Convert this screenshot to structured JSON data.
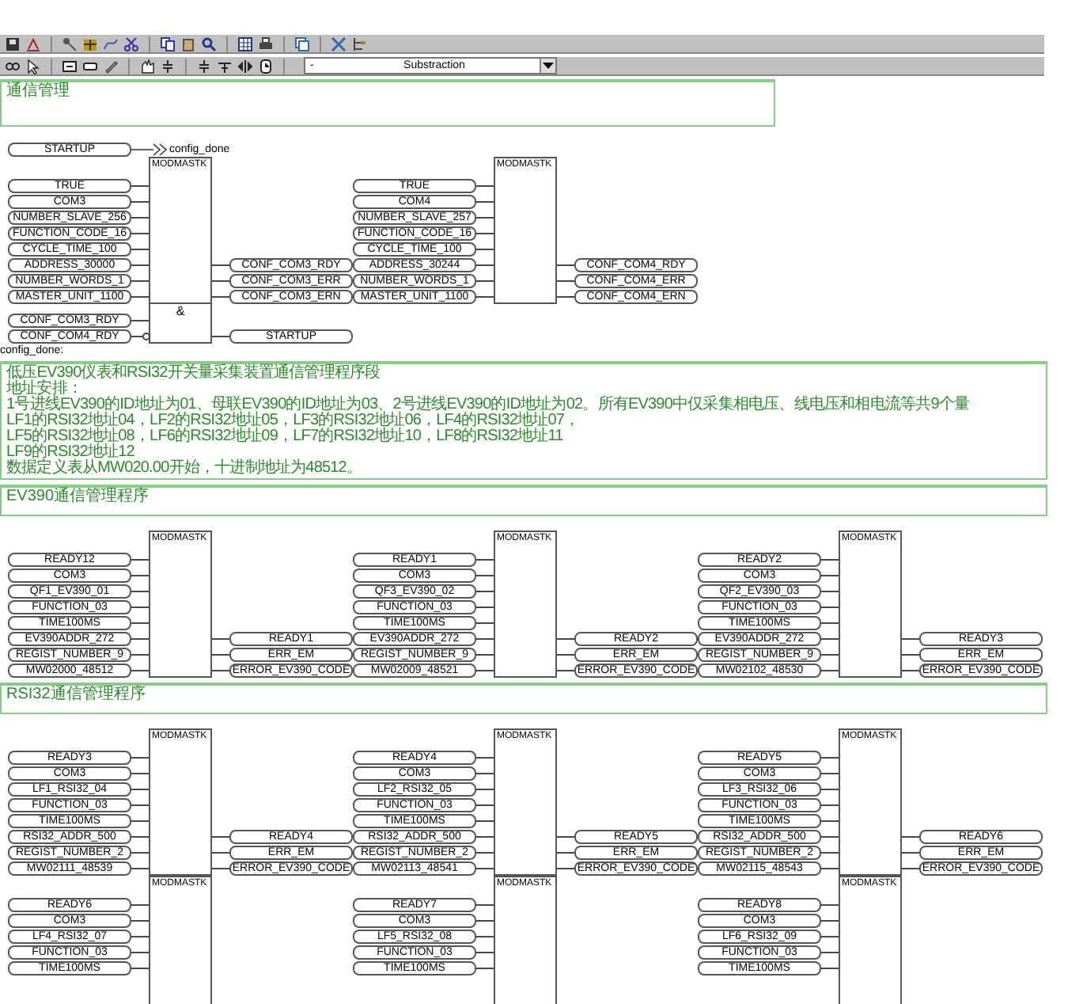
{
  "toolbar": {
    "operator": "-",
    "dropdown_value": "Substraction"
  },
  "title_comment": "通信管理",
  "init_network": {
    "jump": {
      "input": "STARTUP",
      "target": "config_done"
    },
    "blocks": [
      {
        "type": "MODMASTK",
        "inputs": [
          "TRUE",
          "COM3",
          "NUMBER_SLAVE_256",
          "FUNCTION_CODE_16",
          "CYCLE_TIME_100",
          "ADDRESS_30000",
          "NUMBER_WORDS_1",
          "MASTER_UNIT_1100"
        ],
        "outputs": [
          "CONF_COM3_RDY",
          "CONF_COM3_ERR",
          "CONF_COM3_ERN"
        ]
      },
      {
        "type": "MODMASTK",
        "inputs": [
          "TRUE",
          "COM4",
          "NUMBER_SLAVE_257",
          "FUNCTION_CODE_16",
          "CYCLE_TIME_100",
          "ADDRESS_30244",
          "NUMBER_WORDS_1",
          "MASTER_UNIT_1100"
        ],
        "outputs": [
          "CONF_COM4_RDY",
          "CONF_COM4_ERR",
          "CONF_COM4_ERN"
        ]
      }
    ],
    "and_gate": {
      "symbol": "&",
      "inputs": [
        {
          "name": "CONF_COM3_RDY",
          "negated": false
        },
        {
          "name": "CONF_COM4_RDY",
          "negated": true
        }
      ],
      "output": "STARTUP"
    }
  },
  "label": "config_done:",
  "description": [
    "低压EV390仪表和RSI32开关量采集装置通信管理程序段",
    "地址安排：",
    "1号进线EV390的ID地址为01、母联EV390的ID地址为03、2号进线EV390的ID地址为02。所有EV390中仅采集相电压、线电压和相电流等共9个量",
    "LF1的RSI32地址04，LF2的RSI32地址05，LF3的RSI32地址06，LF4的RSI32地址07，",
    "LF5的RSI32地址08，LF6的RSI32地址09，LF7的RSI32地址10，LF8的RSI32地址11",
    "LF9的RSI32地址12",
    "数据定义表从MW020.00开始，十进制地址为48512。"
  ],
  "sections": [
    {
      "title": "EV390通信管理程序",
      "rows": [
        [
          {
            "type": "MODMASTK",
            "inputs": [
              "READY12",
              "COM3",
              "QF1_EV390_01",
              "FUNCTION_03",
              "TIME100MS",
              "EV390ADDR_272",
              "REGIST_NUMBER_9",
              "MW02000_48512"
            ],
            "outputs": [
              "READY1",
              "ERR_EM",
              "ERROR_EV390_CODE"
            ]
          },
          {
            "type": "MODMASTK",
            "inputs": [
              "READY1",
              "COM3",
              "QF3_EV390_02",
              "FUNCTION_03",
              "TIME100MS",
              "EV390ADDR_272",
              "REGIST_NUMBER_9",
              "MW02009_48521"
            ],
            "outputs": [
              "READY2",
              "ERR_EM",
              "ERROR_EV390_CODE"
            ]
          },
          {
            "type": "MODMASTK",
            "inputs": [
              "READY2",
              "COM3",
              "QF2_EV390_03",
              "FUNCTION_03",
              "TIME100MS",
              "EV390ADDR_272",
              "REGIST_NUMBER_9",
              "MW02102_48530"
            ],
            "outputs": [
              "READY3",
              "ERR_EM",
              "ERROR_EV390_CODE"
            ]
          }
        ]
      ]
    },
    {
      "title": "RSI32通信管理程序",
      "rows": [
        [
          {
            "type": "MODMASTK",
            "inputs": [
              "READY3",
              "COM3",
              "LF1_RSI32_04",
              "FUNCTION_03",
              "TIME100MS",
              "RSI32_ADDR_500",
              "REGIST_NUMBER_2",
              "MW02111_48539"
            ],
            "outputs": [
              "READY4",
              "ERR_EM",
              "ERROR_EV390_CODE"
            ]
          },
          {
            "type": "MODMASTK",
            "inputs": [
              "READY4",
              "COM3",
              "LF2_RSI32_05",
              "FUNCTION_03",
              "TIME100MS",
              "RSI32_ADDR_500",
              "REGIST_NUMBER_2",
              "MW02113_48541"
            ],
            "outputs": [
              "READY5",
              "ERR_EM",
              "ERROR_EV390_CODE"
            ]
          },
          {
            "type": "MODMASTK",
            "inputs": [
              "READY5",
              "COM3",
              "LF3_RSI32_06",
              "FUNCTION_03",
              "TIME100MS",
              "RSI32_ADDR_500",
              "REGIST_NUMBER_2",
              "MW02115_48543"
            ],
            "outputs": [
              "READY6",
              "ERR_EM",
              "ERROR_EV390_CODE"
            ]
          }
        ],
        [
          {
            "type": "MODMASTK",
            "inputs": [
              "READY6",
              "COM3",
              "LF4_RSI32_07",
              "FUNCTION_03",
              "TIME100MS"
            ]
          },
          {
            "type": "MODMASTK",
            "inputs": [
              "READY7",
              "COM3",
              "LF5_RSI32_08",
              "FUNCTION_03",
              "TIME100MS"
            ]
          },
          {
            "type": "MODMASTK",
            "inputs": [
              "READY8",
              "COM3",
              "LF6_RSI32_09",
              "FUNCTION_03",
              "TIME100MS"
            ]
          }
        ]
      ]
    }
  ]
}
